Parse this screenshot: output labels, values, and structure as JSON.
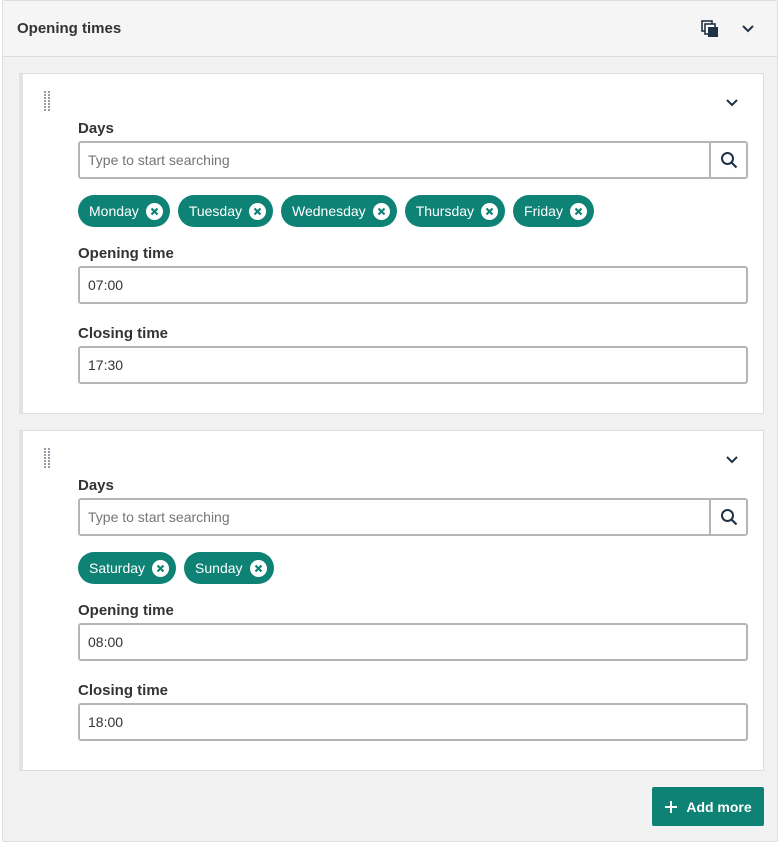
{
  "panel": {
    "title": "Opening times",
    "icons": {
      "duplicate": "copy-stack-icon",
      "collapse": "chevron-down-icon"
    }
  },
  "entries": [
    {
      "days_label": "Days",
      "search_placeholder": "Type to start searching",
      "selected_days": [
        "Monday",
        "Tuesday",
        "Wednesday",
        "Thursday",
        "Friday"
      ],
      "opening_label": "Opening time",
      "opening_value": "07:00",
      "closing_label": "Closing time",
      "closing_value": "17:30"
    },
    {
      "days_label": "Days",
      "search_placeholder": "Type to start searching",
      "selected_days": [
        "Saturday",
        "Sunday"
      ],
      "opening_label": "Opening time",
      "opening_value": "08:00",
      "closing_label": "Closing time",
      "closing_value": "18:00"
    }
  ],
  "add_more_label": "Add more",
  "colors": {
    "accent": "#0d8275",
    "panel_bg": "#f2f2f2",
    "border": "#b5b5b5",
    "text": "#333333"
  }
}
